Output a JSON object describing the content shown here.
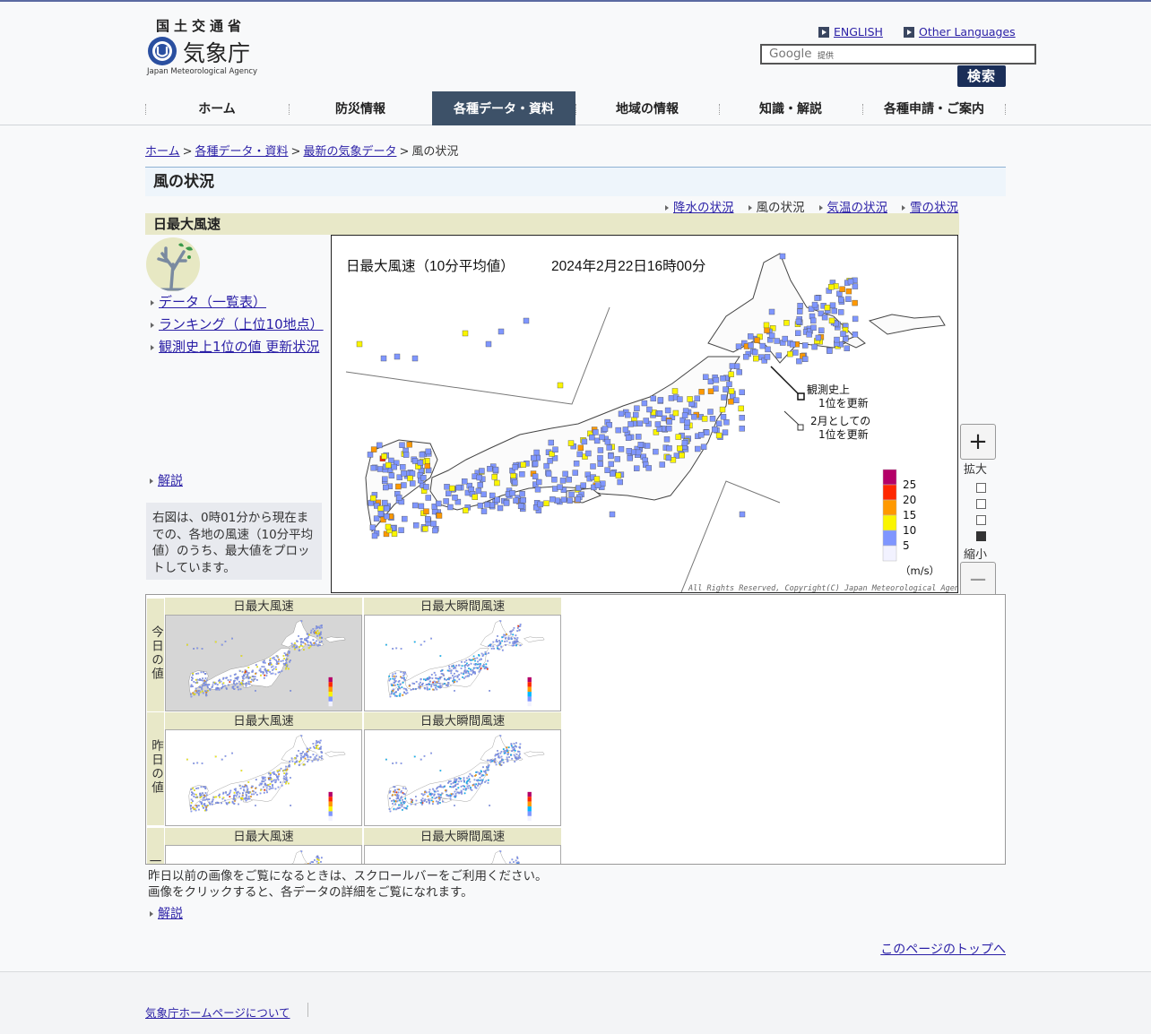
{
  "header": {
    "ministry": "国土交通省",
    "agency": "気象庁",
    "agency_en": "Japan Meteorological Agency",
    "lang_english": "ENGLISH",
    "lang_other": "Other Languages",
    "search_logo": "Google",
    "search_provided": "提供",
    "search_button": "検索"
  },
  "nav": [
    "ホーム",
    "防災情報",
    "各種データ・資料",
    "地域の情報",
    "知識・解説",
    "各種申請・ご案内"
  ],
  "breadcrumb": {
    "home": "ホーム",
    "data": "各種データ・資料",
    "latest": "最新の気象データ",
    "current": "風の状況",
    "sep": ">"
  },
  "page_title": "風の状況",
  "subnav": [
    "降水の状況",
    "風の状況",
    "気温の状況",
    "雪の状況"
  ],
  "section_title": "日最大風速",
  "side_links": [
    "データ（一覧表）",
    "ランキング（上位10地点）",
    "観測史上1位の値 更新状況"
  ],
  "explain": "解説",
  "note": "右図は、0時01分から現在までの、各地の風速（10分平均値）のうち、最大値をプロットしています。",
  "map": {
    "title": "日最大風速（10分平均値）",
    "datetime": "2024年2月22日16時00分",
    "record1_line1": "観測史上",
    "record1_line2": "1位を更新",
    "record2_line1": "2月としての",
    "record2_line2": "1位を更新",
    "legend_values": [
      "25",
      "20",
      "15",
      "10",
      "5"
    ],
    "legend_colors": [
      "#b40068",
      "#ff2800",
      "#ff9900",
      "#faf500",
      "#7f96ff",
      "#f2f2ff"
    ],
    "unit": "（m/s）",
    "copyright": "All Rights Reserved, Copyright(C) Japan Meteorological Agency"
  },
  "zoom": {
    "in_label": "拡大",
    "out_label": "縮小",
    "plus": "+",
    "minus": "−"
  },
  "gallery": {
    "today_label": "今日の値",
    "yesterday_label": "昨日の値",
    "daybefore_label": "一",
    "cap_max": "日最大風速",
    "cap_gust": "日最大瞬間風速"
  },
  "footer_note_line1": "昨日以前の画像をご覧になるときは、スクロールバーをご利用ください。",
  "footer_note_line2": "画像をクリックすると、各データの詳細をご覧になれます。",
  "page_top": "このページのトップへ",
  "footer_link": "気象庁ホームページについて"
}
